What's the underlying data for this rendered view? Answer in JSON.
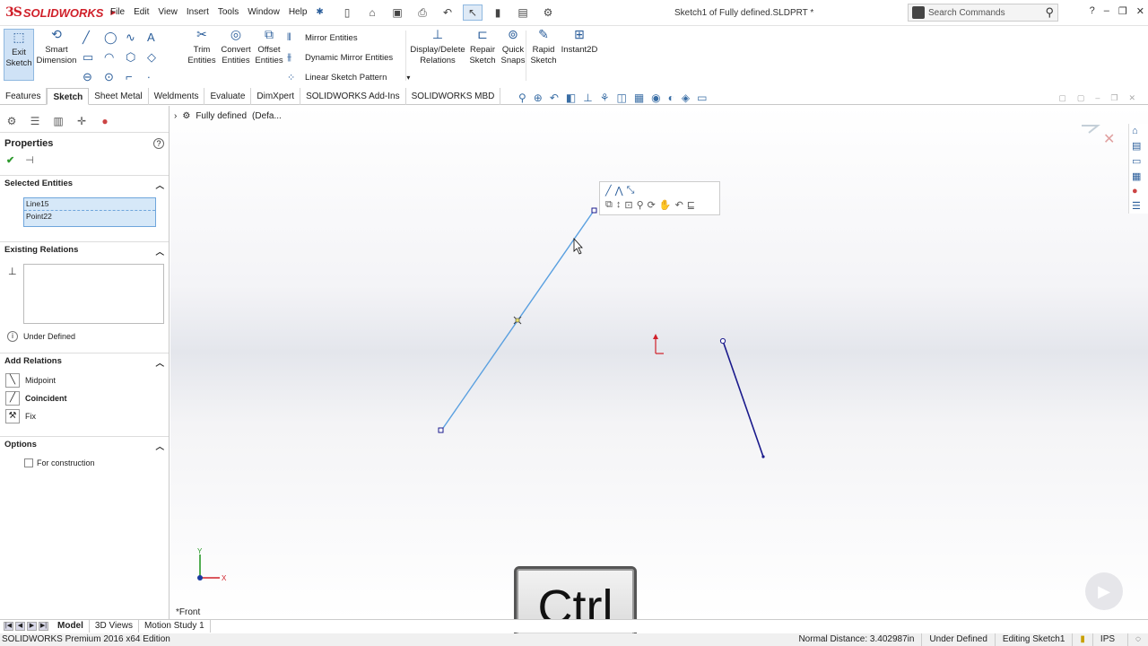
{
  "app": {
    "logo_ds": "3S",
    "logo_brand": "SOLIDWORKS",
    "document_title": "Sketch1 of Fully defined.SLDPRT *"
  },
  "menu": [
    "File",
    "Edit",
    "View",
    "Insert",
    "Tools",
    "Window",
    "Help"
  ],
  "search": {
    "placeholder": "Search Commands"
  },
  "command_manager": {
    "exit_sketch": "Exit Sketch",
    "smart_dimension": "Smart Dimension",
    "trim_entities": "Trim Entities",
    "convert_entities": "Convert Entities",
    "offset_entities": "Offset Entities",
    "mirror_entities": "Mirror Entities",
    "dynamic_mirror_entities": "Dynamic Mirror Entities",
    "linear_sketch_pattern": "Linear Sketch Pattern",
    "display_delete_relations": "Display/Delete Relations",
    "repair_sketch": "Repair Sketch",
    "quick_snaps": "Quick Snaps",
    "rapid_sketch": "Rapid Sketch",
    "instant2d": "Instant2D"
  },
  "tabs": [
    "Features",
    "Sketch",
    "Sheet Metal",
    "Weldments",
    "Evaluate",
    "DimXpert",
    "SOLIDWORKS Add-Ins",
    "SOLIDWORKS MBD"
  ],
  "active_tab": "Sketch",
  "tree_flyout": {
    "name": "Fully defined",
    "config": "(Defa..."
  },
  "property_manager": {
    "title": "Properties",
    "selected_entities": {
      "header": "Selected Entities",
      "items": [
        "Line15",
        "Point22"
      ]
    },
    "existing_relations": {
      "header": "Existing Relations",
      "status": "Under Defined"
    },
    "add_relations": {
      "header": "Add Relations",
      "items": [
        "Midpoint",
        "Coincident",
        "Fix"
      ]
    },
    "options": {
      "header": "Options",
      "for_construction": "For construction"
    }
  },
  "viewport": {
    "view_name": "*Front",
    "triad_x": "X",
    "triad_y": "Y",
    "key_overlay": "Ctrl"
  },
  "bottom_tabs": [
    "Model",
    "3D Views",
    "Motion Study 1"
  ],
  "status": {
    "edition": "SOLIDWORKS Premium 2016 x64 Edition",
    "normal_distance": "Normal Distance: 3.402987in",
    "sketch_state": "Under Defined",
    "editing": "Editing Sketch1",
    "units": "IPS"
  },
  "colors": {
    "accent": "#d0202a",
    "selected_line": "#5aa0e0",
    "sketch_line": "#1a1a8c"
  }
}
